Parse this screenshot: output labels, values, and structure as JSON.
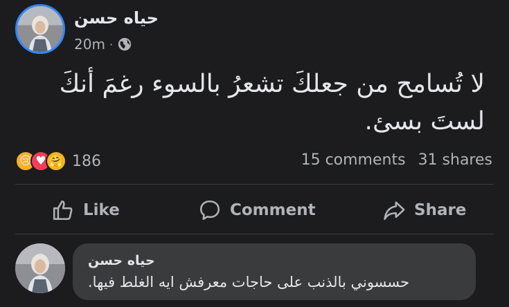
{
  "post": {
    "author": "حياه حسن",
    "time": "20m",
    "separator": "·",
    "privacy_icon": "globe-icon",
    "text": "لا تُسامح من جعلكَ تشعرُ بالسوء رغمَ أنكَ لستَ بسئ."
  },
  "stats": {
    "reaction_icons": [
      "sad-emoji",
      "love-emoji",
      "care-emoji"
    ],
    "reaction_count": "186",
    "comments": "15 comments",
    "shares": "31 shares"
  },
  "actions": {
    "like": "Like",
    "comment": "Comment",
    "share": "Share"
  },
  "comment": {
    "author": "حياه حسن",
    "text": "حسسوني بالذنب على حاجات معرفش ايه الغلط فيها."
  },
  "colors": {
    "background": "#1c1c1e",
    "text": "#e4e6eb",
    "secondary_text": "#b0b3b8",
    "bubble": "#3a3b3c",
    "story_ring": "#2d88ff"
  }
}
